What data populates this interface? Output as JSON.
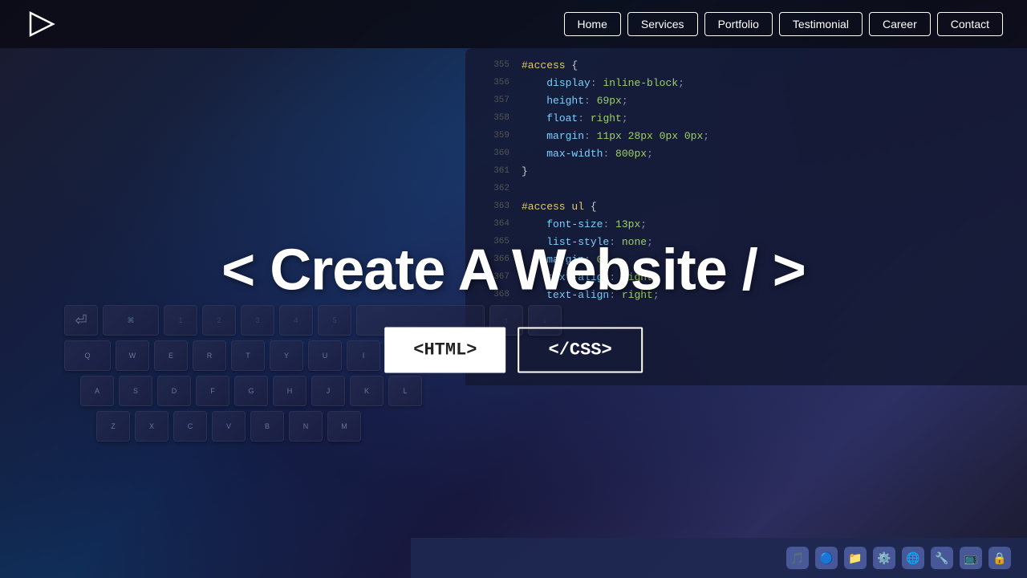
{
  "navbar": {
    "logo_alt": "Play Logo",
    "links": [
      {
        "label": "Home",
        "id": "home"
      },
      {
        "label": "Services",
        "id": "services"
      },
      {
        "label": "Portfolio",
        "id": "portfolio"
      },
      {
        "label": "Testimonial",
        "id": "testimonial"
      },
      {
        "label": "Career",
        "id": "career"
      },
      {
        "label": "Contact",
        "id": "contact"
      }
    ]
  },
  "hero": {
    "title": "< Create A Website / >",
    "btn_html": "<HTML>",
    "btn_css": "</CSS>"
  },
  "code_lines": [
    {
      "num": "355",
      "content": "#access {",
      "type": "selector"
    },
    {
      "num": "356",
      "content": "    display: inline-block;",
      "type": "property-value"
    },
    {
      "num": "357",
      "content": "    height: 69px;",
      "type": "property-value"
    },
    {
      "num": "358",
      "content": "    float: right;",
      "type": "property-value"
    },
    {
      "num": "359",
      "content": "    margin: 11px 28px 0px 0px;",
      "type": "property-value"
    },
    {
      "num": "360",
      "content": "    max-width: 800px;",
      "type": "property-value"
    },
    {
      "num": "361",
      "content": "}",
      "type": "brace"
    },
    {
      "num": "362",
      "content": "",
      "type": "empty"
    },
    {
      "num": "363",
      "content": "#access ul {",
      "type": "selector"
    },
    {
      "num": "364",
      "content": "    font-size: 13px;",
      "type": "property-value"
    },
    {
      "num": "365",
      "content": "    list-style: none;",
      "type": "property-value"
    },
    {
      "num": "366",
      "content": "    margin: 0;",
      "type": "property-value"
    },
    {
      "num": "367",
      "content": "    text-align: right;",
      "type": "property-value"
    },
    {
      "num": "368",
      "content": "    text-align: right;",
      "type": "property-value"
    }
  ]
}
